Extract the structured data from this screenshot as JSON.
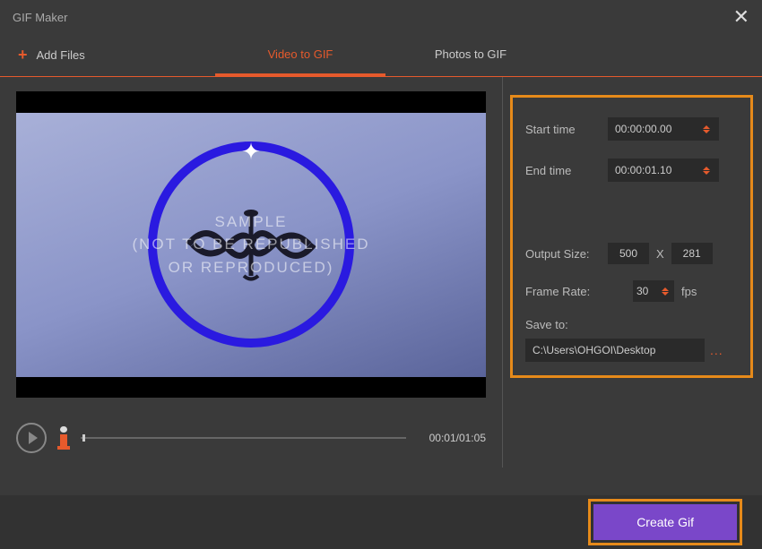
{
  "titlebar": {
    "title": "GIF Maker"
  },
  "toolbar": {
    "add_files": "Add Files"
  },
  "tabs": {
    "video": "Video to GIF",
    "photos": "Photos to GIF"
  },
  "preview": {
    "watermark_line1": "SAMPLE",
    "watermark_line2": "(NOT TO BE REPUBLISHED",
    "watermark_line3": "OR REPRODUCED)",
    "timecode": "00:01/01:05"
  },
  "settings": {
    "start_label": "Start time",
    "start_value": "00:00:00.00",
    "end_label": "End time",
    "end_value": "00:00:01.10",
    "output_size_label": "Output Size:",
    "width": "500",
    "x": "X",
    "height": "281",
    "frame_rate_label": "Frame Rate:",
    "fps_value": "30",
    "fps_unit": "fps",
    "save_to_label": "Save to:",
    "save_path": "C:\\Users\\OHGOI\\Desktop",
    "browse": "..."
  },
  "footer": {
    "create": "Create Gif"
  }
}
